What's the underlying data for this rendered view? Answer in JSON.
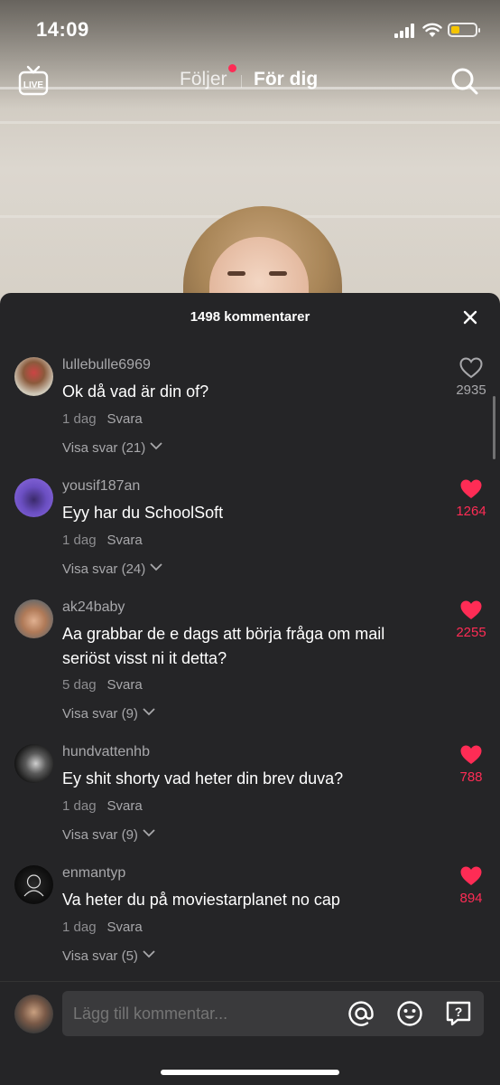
{
  "status_bar": {
    "time": "14:09",
    "battery_color": "#f5c400"
  },
  "top_nav": {
    "live_icon": "live-tv-icon",
    "live_label": "LIVE",
    "tabs": [
      {
        "label": "Följer",
        "active": false,
        "has_dot": true
      },
      {
        "label": "För dig",
        "active": true
      }
    ],
    "search_icon": "search-icon",
    "dot_color": "#fe2c55"
  },
  "comments_sheet": {
    "title": "1498 kommentarer",
    "close_icon": "close-icon",
    "comments": [
      {
        "username": "lullebulle6969",
        "text": "Ok då vad är din of?",
        "time": "1 dag",
        "reply_label": "Svara",
        "view_replies": "Visa svar (21)",
        "likes": "2935",
        "liked": false
      },
      {
        "username": "yousif187an",
        "text": "Eyy har du SchoolSoft",
        "time": "1 dag",
        "reply_label": "Svara",
        "view_replies": "Visa svar (24)",
        "likes": "1264",
        "liked": true
      },
      {
        "username": "ak24baby",
        "text": "Aa grabbar de e dags att börja fråga om mail seriöst visst ni it detta?",
        "time": "5 dag",
        "reply_label": "Svara",
        "view_replies": "Visa svar (9)",
        "likes": "2255",
        "liked": true
      },
      {
        "username": "hundvattenhb",
        "text": "Ey shit shorty vad heter din brev duva?",
        "time": "1 dag",
        "reply_label": "Svara",
        "view_replies": "Visa svar (9)",
        "likes": "788",
        "liked": true
      },
      {
        "username": "enmantyp",
        "text": "Va heter du på moviestarplanet no cap",
        "time": "1 dag",
        "reply_label": "Svara",
        "view_replies": "Visa svar (5)",
        "likes": "894",
        "liked": true
      }
    ],
    "liked_color": "#fe2c55",
    "unliked_color": "#a8a8ab"
  },
  "input_bar": {
    "placeholder": "Lägg till kommentar...",
    "icons": [
      "mention-icon",
      "emoji-icon",
      "question-icon"
    ]
  }
}
